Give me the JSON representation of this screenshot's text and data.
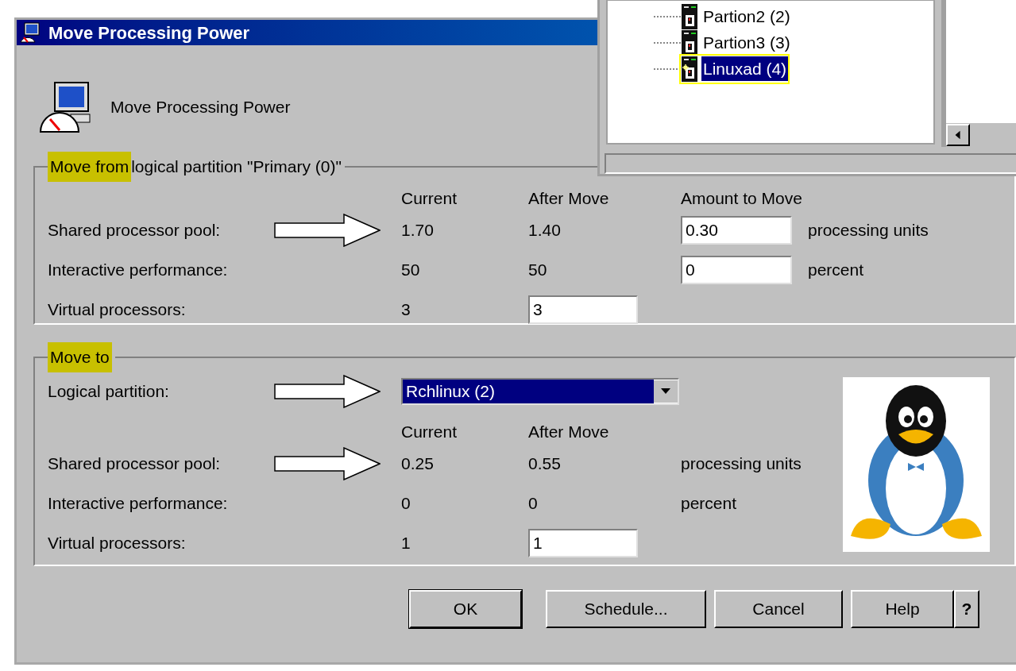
{
  "dialog": {
    "title": "Move Processing Power",
    "heading": "Move Processing Power",
    "from": {
      "legend_highlight": "Move from",
      "legend_rest": "logical partition \"Primary (0)\"",
      "columns": [
        "Current",
        "After Move",
        "Amount to Move"
      ],
      "rows": [
        {
          "kind": "readout",
          "label": "Shared processor pool:",
          "arrow": true,
          "current": "1.70",
          "after": "1.40",
          "amount": "0.30",
          "unit": "processing units"
        },
        {
          "kind": "readout",
          "label": "Interactive performance:",
          "arrow": false,
          "current": "50",
          "after": "50",
          "amount": "0",
          "unit": "percent"
        },
        {
          "kind": "editable",
          "label": "Virtual processors:",
          "arrow": false,
          "current": "3",
          "after": "3"
        }
      ]
    },
    "to": {
      "legend_highlight": "Move to",
      "partition_label": "Logical partition:",
      "partition_arrow": true,
      "partition_value": "Rchlinux (2)",
      "columns": [
        "Current",
        "After Move"
      ],
      "rows": [
        {
          "kind": "readout",
          "label": "Shared processor pool:",
          "arrow": true,
          "current": "0.25",
          "after": "0.55",
          "unit": "processing units"
        },
        {
          "kind": "readout",
          "label": "Interactive performance:",
          "arrow": false,
          "current": "0",
          "after": "0",
          "unit": "percent"
        },
        {
          "kind": "editable",
          "label": "Virtual processors:",
          "arrow": false,
          "current": "1",
          "after": "1"
        }
      ]
    },
    "buttons": [
      {
        "label": "OK",
        "kind": "text"
      },
      {
        "label": "Schedule...",
        "kind": "text"
      },
      {
        "label": "Cancel",
        "kind": "text"
      },
      {
        "label": "Help",
        "kind": "text"
      },
      {
        "label": "?",
        "kind": "mini"
      }
    ]
  },
  "tree": {
    "items": [
      {
        "label": "Partion2 (2)",
        "selected": false
      },
      {
        "label": "Partion3 (3)",
        "selected": false
      },
      {
        "label": "Linuxad (4)",
        "selected": true
      }
    ]
  }
}
